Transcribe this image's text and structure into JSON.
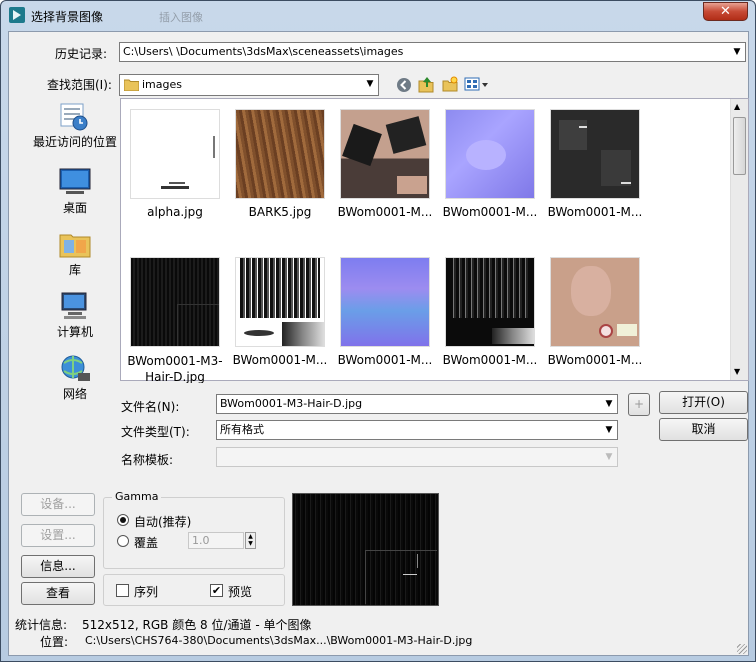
{
  "window": {
    "title": "选择背景图像",
    "ghost_tab": "插入图像",
    "close_label": "✕"
  },
  "history": {
    "label": "历史记录:",
    "path": "C:\\Users\\                         \\Documents\\3dsMax\\sceneassets\\images"
  },
  "lookin": {
    "label": "查找范围(I):",
    "folder": "images"
  },
  "places": [
    {
      "label": "最近访问的位置",
      "icon": "recent-places-icon"
    },
    {
      "label": "桌面",
      "icon": "desktop-icon"
    },
    {
      "label": "库",
      "icon": "libraries-icon"
    },
    {
      "label": "计算机",
      "icon": "computer-icon"
    },
    {
      "label": "网络",
      "icon": "network-icon"
    }
  ],
  "files": [
    {
      "name": "alpha.jpg"
    },
    {
      "name": "BARK5.jpg"
    },
    {
      "name": "BWom0001-M..."
    },
    {
      "name": "BWom0001-M..."
    },
    {
      "name": "BWom0001-M..."
    },
    {
      "name": "BWom0001-M3-Hair-D.jpg"
    },
    {
      "name": "BWom0001-M..."
    },
    {
      "name": "BWom0001-M..."
    },
    {
      "name": "BWom0001-M..."
    },
    {
      "name": "BWom0001-M..."
    }
  ],
  "filename": {
    "label": "文件名(N):",
    "value": "BWom0001-M3-Hair-D.jpg"
  },
  "filetype": {
    "label": "文件类型(T):",
    "value": "所有格式"
  },
  "template": {
    "label": "名称模板:",
    "value": ""
  },
  "buttons": {
    "plus": "+",
    "open": "打开(O)",
    "cancel": "取消",
    "setup": "设备...",
    "settings": "设置...",
    "info": "信息...",
    "view": "查看"
  },
  "gamma": {
    "title": "Gamma",
    "auto_label": "自动(推荐)",
    "override_label": "覆盖",
    "override_value": "1.0"
  },
  "options": {
    "sequence_label": "序列",
    "preview_label": "预览",
    "sequence_checked": false,
    "preview_checked": true
  },
  "stats": {
    "label": "统计信息:",
    "value": "512x512, RGB 颜色 8 位/通道 - 单个图像"
  },
  "location": {
    "label": "位置:",
    "value": "C:\\Users\\CHS764-380\\Documents\\3dsMax...\\BWom0001-M3-Hair-D.jpg"
  },
  "colors": {
    "accent": "#2f6db5",
    "close": "#c74a35"
  }
}
